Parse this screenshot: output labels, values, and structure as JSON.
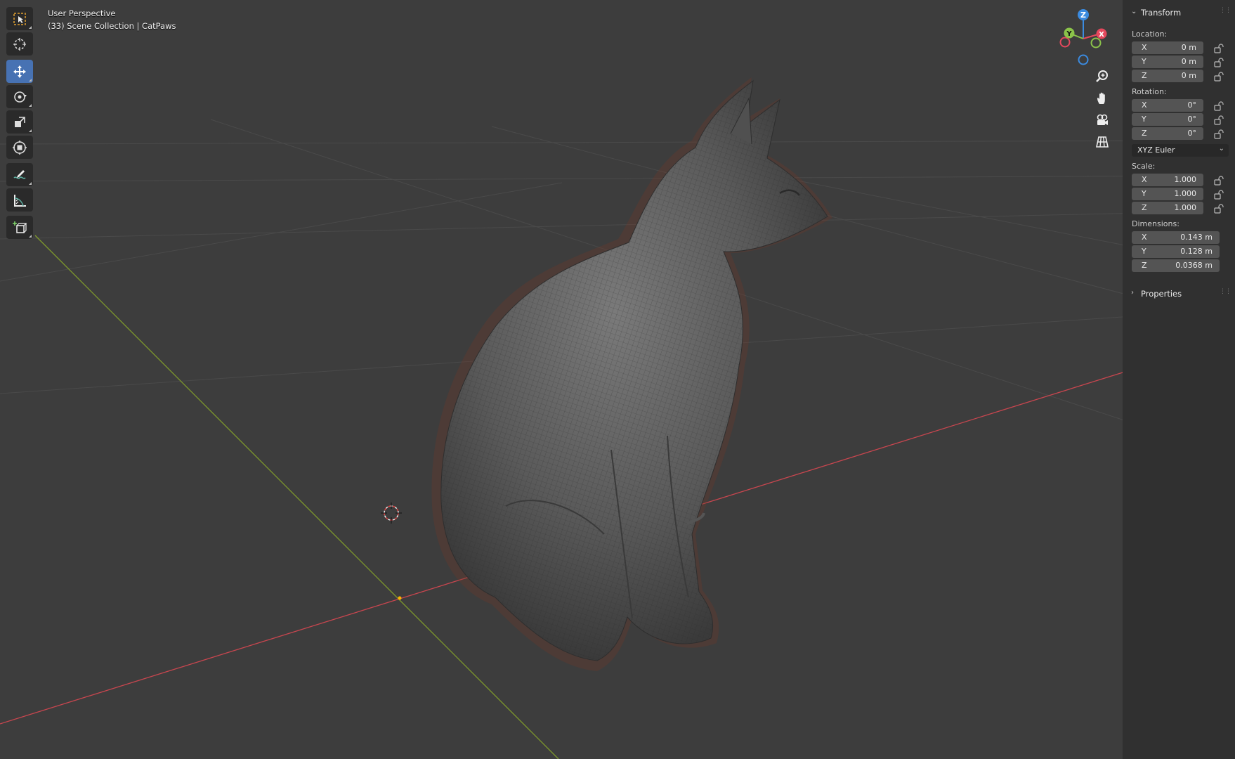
{
  "viewport": {
    "view_name": "User Perspective",
    "collection_line": "(33) Scene Collection | CatPaws"
  },
  "toolbar": {
    "tools": [
      {
        "name": "select-box-tool",
        "icon": "select-box-icon",
        "active": false
      },
      {
        "name": "cursor-tool",
        "icon": "cursor-icon",
        "active": false
      },
      {
        "name": "move-tool",
        "icon": "move-icon",
        "active": true
      },
      {
        "name": "rotate-tool",
        "icon": "rotate-icon",
        "active": false
      },
      {
        "name": "scale-tool",
        "icon": "scale-icon",
        "active": false
      },
      {
        "name": "transform-tool",
        "icon": "transform-icon",
        "active": false
      },
      {
        "name": "annotate-tool",
        "icon": "annotate-icon",
        "active": false
      },
      {
        "name": "measure-tool",
        "icon": "measure-icon",
        "active": false
      },
      {
        "name": "add-cube-tool",
        "icon": "add-cube-icon",
        "active": false
      }
    ]
  },
  "gizmo": {
    "axes": {
      "x": "X",
      "y": "Y",
      "z": "Z"
    },
    "colors": {
      "x": "#e5485d",
      "y": "#8bc34a",
      "z": "#3b8be0"
    }
  },
  "nav_buttons": [
    "zoom-icon",
    "pan-hand-icon",
    "camera-icon",
    "grid-ortho-icon"
  ],
  "transform_panel": {
    "title": "Transform",
    "location_label": "Location:",
    "location": [
      {
        "axis": "X",
        "value": "0 m"
      },
      {
        "axis": "Y",
        "value": "0 m"
      },
      {
        "axis": "Z",
        "value": "0 m"
      }
    ],
    "rotation_label": "Rotation:",
    "rotation": [
      {
        "axis": "X",
        "value": "0°"
      },
      {
        "axis": "Y",
        "value": "0°"
      },
      {
        "axis": "Z",
        "value": "0°"
      }
    ],
    "rotation_mode": "XYZ Euler",
    "scale_label": "Scale:",
    "scale": [
      {
        "axis": "X",
        "value": "1.000"
      },
      {
        "axis": "Y",
        "value": "1.000"
      },
      {
        "axis": "Z",
        "value": "1.000"
      }
    ],
    "dimensions_label": "Dimensions:",
    "dimensions": [
      {
        "axis": "X",
        "value": "0.143 m"
      },
      {
        "axis": "Y",
        "value": "0.128 m"
      },
      {
        "axis": "Z",
        "value": "0.0368 m"
      }
    ]
  },
  "properties_panel": {
    "title": "Properties"
  },
  "colors": {
    "background": "#3d3d3d",
    "active_tool": "#4772b3",
    "x_axis_line": "#c8464f",
    "y_axis_line": "#7f9a2c"
  }
}
